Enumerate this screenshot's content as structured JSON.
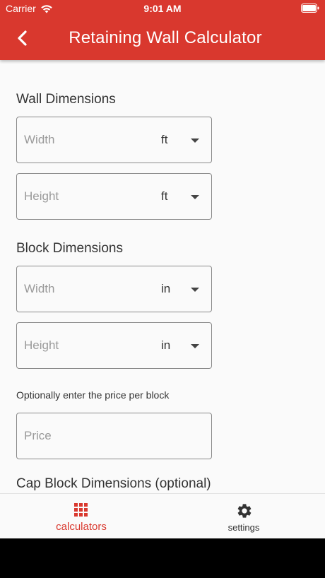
{
  "status_bar": {
    "carrier": "Carrier",
    "time": "9:01 AM"
  },
  "header": {
    "title": "Retaining Wall Calculator"
  },
  "wall_dimensions": {
    "title": "Wall Dimensions",
    "width": {
      "placeholder": "Width",
      "unit": "ft"
    },
    "height": {
      "placeholder": "Height",
      "unit": "ft"
    }
  },
  "block_dimensions": {
    "title": "Block Dimensions",
    "width": {
      "placeholder": "Width",
      "unit": "in"
    },
    "height": {
      "placeholder": "Height",
      "unit": "in"
    }
  },
  "price": {
    "hint": "Optionally enter the price per block",
    "placeholder": "Price"
  },
  "cap_block": {
    "title": "Cap Block Dimensions (optional)"
  },
  "bottom_nav": {
    "items": [
      {
        "label": "calculators",
        "icon": "grid-icon",
        "active": true
      },
      {
        "label": "settings",
        "icon": "gear-icon",
        "active": false
      }
    ]
  },
  "colors": {
    "accent": "#d9382e",
    "background": "#fafafa"
  }
}
